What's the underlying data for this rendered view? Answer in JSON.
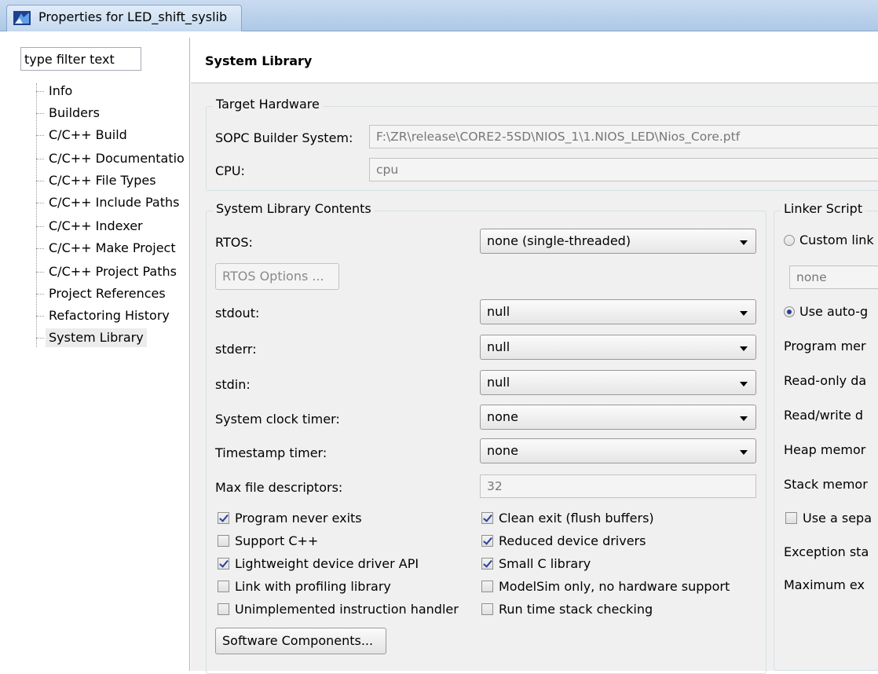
{
  "window": {
    "title": "Properties for LED_shift_syslib",
    "icon": "nios-app-icon"
  },
  "filter": {
    "placeholder": "type filter text",
    "value": "type filter text"
  },
  "tree": {
    "items": [
      {
        "label": "Info"
      },
      {
        "label": "Builders"
      },
      {
        "label": "C/C++ Build"
      },
      {
        "label": "C/C++ Documentatio"
      },
      {
        "label": "C/C++ File Types"
      },
      {
        "label": "C/C++ Include Paths"
      },
      {
        "label": "C/C++ Indexer"
      },
      {
        "label": "C/C++ Make Project"
      },
      {
        "label": "C/C++ Project Paths"
      },
      {
        "label": "Project References"
      },
      {
        "label": "Refactoring History"
      },
      {
        "label": "System Library"
      }
    ],
    "selected": "System Library"
  },
  "page": {
    "title": "System Library"
  },
  "target_hardware": {
    "group_label": "Target Hardware",
    "sopc_label": "SOPC Builder System:",
    "sopc_value": "F:\\ZR\\release\\CORE2-5SD\\NIOS_1\\1.NIOS_LED\\Nios_Core.ptf",
    "cpu_label": "CPU:",
    "cpu_value": "cpu"
  },
  "contents": {
    "group_label": "System Library Contents",
    "rtos_label": "RTOS:",
    "rtos_value": "none (single-threaded)",
    "rtos_options_button": "RTOS Options ...",
    "stdout_label": "stdout:",
    "stdout_value": "null",
    "stderr_label": "stderr:",
    "stderr_value": "null",
    "stdin_label": "stdin:",
    "stdin_value": "null",
    "sys_clock_label": "System clock timer:",
    "sys_clock_value": "none",
    "timestamp_label": "Timestamp timer:",
    "timestamp_value": "none",
    "max_fd_label": "Max file descriptors:",
    "max_fd_value": "32",
    "checkboxes": [
      {
        "label": "Program never exits",
        "checked": true
      },
      {
        "label": "Clean exit (flush buffers)",
        "checked": true
      },
      {
        "label": "Support C++",
        "checked": false
      },
      {
        "label": "Reduced device drivers",
        "checked": true
      },
      {
        "label": "Lightweight device driver API",
        "checked": true
      },
      {
        "label": "Small C library",
        "checked": true
      },
      {
        "label": "Link with profiling library",
        "checked": false
      },
      {
        "label": "ModelSim only, no hardware support",
        "checked": false
      },
      {
        "label": "Unimplemented instruction handler",
        "checked": false
      },
      {
        "label": "Run time stack checking",
        "checked": false
      }
    ],
    "software_components_button": "Software Components..."
  },
  "linker": {
    "group_label": "Linker Script",
    "custom_label": "Custom link",
    "custom_selected": false,
    "custom_value": "none",
    "auto_label": "Use auto-g",
    "auto_selected": true,
    "program_mem_label": "Program mer",
    "readonly_label": "Read-only da",
    "readwrite_label": "Read/write d",
    "heap_label": "Heap memor",
    "stack_label": "Stack memor",
    "separate_label": "Use a sepa",
    "separate_checked": false,
    "exception_label": "Exception sta",
    "maximum_label": "Maximum ex"
  }
}
